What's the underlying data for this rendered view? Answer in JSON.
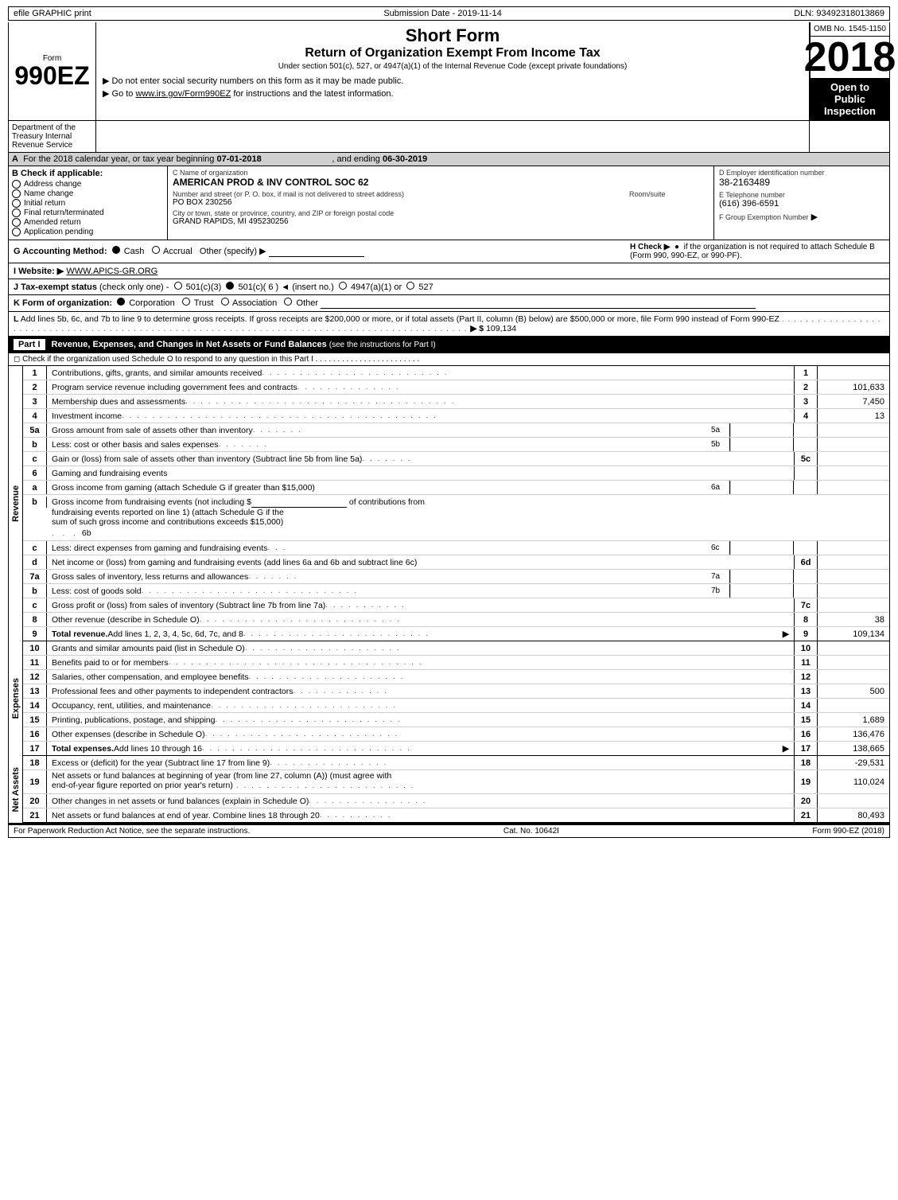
{
  "topbar": {
    "efile": "efile GRAPHIC print",
    "submission": "Submission Date - 2019-11-14",
    "dln": "DLN: 93492318013869"
  },
  "header": {
    "omb": "OMB No. 1545-1150",
    "form_label": "Form",
    "form_number": "990EZ",
    "short_form": "Short Form",
    "return_title": "Return of Organization Exempt From Income Tax",
    "under_title": "Under section 501(c), 527, or 4947(a)(1) of the Internal Revenue Code (except private foundations)",
    "year": "2018",
    "open_label": "Open to",
    "public_label": "Public",
    "inspection_label": "Inspection",
    "notice1": "▶ Do not enter social security numbers on this form as it may be made public.",
    "notice2": "▶ Go to www.irs.gov/Form990EZ for instructions and the latest information."
  },
  "dept": {
    "name": "Department of the Treasury Internal Revenue Service"
  },
  "section_a": {
    "text": "A  For the 2018 calendar year, or tax year beginning 07-01-2018",
    "text2": ", and ending 06-30-2019"
  },
  "checkboxes": {
    "b_label": "B  Check if applicable:",
    "address_change": "Address change",
    "name_change": "Name change",
    "initial_return": "Initial return",
    "final_return": "Final return/terminated",
    "amended_return": "Amended return",
    "application_pending": "Application pending"
  },
  "org": {
    "c_label": "C Name of organization",
    "name": "AMERICAN PROD & INV CONTROL SOC 62",
    "address_label": "Number and street (or P. O. box, if mail is not delivered to street address)",
    "address": "PO BOX 230256",
    "room_label": "Room/suite",
    "room": "",
    "city_label": "City or town, state or province, country, and ZIP or foreign postal code",
    "city": "GRAND RAPIDS, MI  495230256"
  },
  "employer": {
    "d_label": "D Employer identification number",
    "ein": "38-2163489",
    "e_label": "E Telephone number",
    "phone": "(616) 396-6591",
    "f_label": "F Group Exemption Number",
    "f_arrow": "▶"
  },
  "accounting": {
    "g_label": "G Accounting Method:",
    "cash": "Cash",
    "accrual": "Accrual",
    "other": "Other (specify) ▶",
    "other_field": "",
    "h_label": "H  Check ▶",
    "h_circle": "●",
    "h_text": "if the organization is not required to attach Schedule B (Form 990, 990-EZ, or 990-PF)."
  },
  "website": {
    "i_label": "I Website: ▶",
    "url": "WWW.APICS-GR.ORG"
  },
  "tax_status": {
    "j_label": "J Tax-exempt status",
    "j_sub": "(check only one) -",
    "c3": "501(c)(3)",
    "c6": "501(c)( 6 )",
    "insert": "◄ (insert no.)",
    "c4947": "4947(a)(1) or",
    "c527": "527"
  },
  "form_org": {
    "k_label": "K Form of organization:",
    "corporation": "Corporation",
    "trust": "Trust",
    "association": "Association",
    "other": "Other"
  },
  "l_row": {
    "text": "L Add lines 5b, 6c, and 7b to line 9 to determine gross receipts. If gross receipts are $200,000 or more, or if total assets (Part II, column (B) below) are $500,000 or more, file Form 990 instead of Form 990-EZ",
    "dots": ". . . . . . . . . . . . . . . . . . . . . . . . . . . . . . . . . . . . . . . . . .",
    "arrow": "▶ $",
    "value": "109,134"
  },
  "part1": {
    "label": "Part I",
    "title": "Revenue, Expenses, and Changes in Net Assets or Fund Balances",
    "title_sub": "(see the instructions for Part I)",
    "check_row": "Check if the organization used Schedule O to respond to any question in this Part I . . . . . . . . . . . . . . . . . . . . . . . .",
    "check_box": "◻"
  },
  "rows": [
    {
      "num": "1",
      "desc": "Contributions, gifts, grants, and similar amounts received . . . . . . . . . . . . . . . . . . . . . . . . .",
      "line": "1",
      "value": ""
    },
    {
      "num": "2",
      "desc": "Program service revenue including government fees and contracts . . . . . . . . . . . . . .",
      "line": "2",
      "value": "101,633"
    },
    {
      "num": "3",
      "desc": "Membership dues and assessments . . . . . . . . . . . . . . . . . . . . . . . . . . . . . . . . . . .",
      "line": "3",
      "value": "7,450"
    },
    {
      "num": "4",
      "desc": "Investment income . . . . . . . . . . . . . . . . . . . . . . . . . . . . . . . . . . . . . . . . . .",
      "line": "4",
      "value": "13"
    }
  ],
  "row5a": {
    "num": "5a",
    "desc": "Gross amount from sale of assets other than inventory . . . . . . .",
    "sub": "5a",
    "line": "",
    "value": ""
  },
  "row5b": {
    "num": "b",
    "desc": "Less: cost or other basis and sales expenses . . . . . . . .",
    "sub": "5b",
    "line": "",
    "value": ""
  },
  "row5c": {
    "num": "c",
    "desc": "Gain or (loss) from sale of assets other than inventory (Subtract line 5b from line 5a) . . . . . . .",
    "line": "5c",
    "value": ""
  },
  "row6": {
    "num": "6",
    "desc": "Gaming and fundraising events",
    "line": "",
    "value": ""
  },
  "row6a": {
    "num": "a",
    "desc": "Gross income from gaming (attach Schedule G if greater than $15,000)",
    "sub": "6a",
    "line": "",
    "value": ""
  },
  "row6b_text": "Gross income from fundraising events (not including $",
  "row6b_text2": "of contributions from fundraising events reported on line 1) (attach Schedule G if the sum of such gross income and contributions exceeds $15,000)",
  "row6b_sub": "6b",
  "row6c": {
    "num": "c",
    "desc": "Less: direct expenses from gaming and fundraising events",
    "sub": "6c",
    "value": ""
  },
  "row6d": {
    "num": "d",
    "desc": "Net income or (loss) from gaming and fundraising events (add lines 6a and 6b and subtract line 6c)",
    "line": "6d",
    "value": ""
  },
  "row7a": {
    "num": "7a",
    "desc": "Gross sales of inventory, less returns and allowances . . . . . . .",
    "sub": "7a",
    "value": ""
  },
  "row7b": {
    "num": "b",
    "desc": "Less: cost of goods sold . . . . . . . . . . . . . . . . . . . . . . . .",
    "sub": "7b",
    "value": ""
  },
  "row7c": {
    "num": "c",
    "desc": "Gross profit or (loss) from sales of inventory (Subtract line 7b from line 7a) . . . . . . . . . . . .",
    "line": "7c",
    "value": ""
  },
  "row8": {
    "num": "8",
    "desc": "Other revenue (describe in Schedule O) . . . . . . . . . . . . . . . . . . . . . . . . . . . . . .",
    "line": "8",
    "value": "38"
  },
  "row9": {
    "num": "9",
    "desc": "Total revenue. Add lines 1, 2, 3, 4, 5c, 6d, 7c, and 8 . . . . . . . . . . . . . . . . . . . . . . . . . .",
    "line": "9",
    "value": "109,134",
    "arrow": "▶"
  },
  "row10": {
    "num": "10",
    "desc": "Grants and similar amounts paid (list in Schedule O) . . . . . . . . . . . . . . . . . . . . . .",
    "line": "10",
    "value": ""
  },
  "row11": {
    "num": "11",
    "desc": "Benefits paid to or for members . . . . . . . . . . . . . . . . . . . . . . . . . . . . . . . . . .",
    "line": "11",
    "value": ""
  },
  "row12": {
    "num": "12",
    "desc": "Salaries, other compensation, and employee benefits . . . . . . . . . . . . . . . . . . . . .",
    "line": "12",
    "value": ""
  },
  "row13": {
    "num": "13",
    "desc": "Professional fees and other payments to independent contractors . . . . . . . . . . . . . .",
    "line": "13",
    "value": "500"
  },
  "row14": {
    "num": "14",
    "desc": "Occupancy, rent, utilities, and maintenance . . . . . . . . . . . . . . . . . . . . . . . . . . .",
    "line": "14",
    "value": ""
  },
  "row15": {
    "num": "15",
    "desc": "Printing, publications, postage, and shipping . . . . . . . . . . . . . . . . . . . . . . . . . .",
    "line": "15",
    "value": "1,689"
  },
  "row16": {
    "num": "16",
    "desc": "Other expenses (describe in Schedule O) . . . . . . . . . . . . . . . . . . . . . . . . . . . .",
    "line": "16",
    "value": "136,476"
  },
  "row17": {
    "num": "17",
    "desc": "Total expenses. Add lines 10 through 16 . . . . . . . . . . . . . . . . . . . . . . . . . . . . .",
    "line": "17",
    "value": "138,665",
    "arrow": "▶"
  },
  "row18": {
    "num": "18",
    "desc": "Excess or (deficit) for the year (Subtract line 17 from line 9) . . . . . . . . . . . . . . . . .",
    "line": "18",
    "value": "-29,531"
  },
  "row19_text": "Net assets or fund balances at beginning of year (from line 27, column (A)) (must agree with end-of-year figure reported on prior year's return)",
  "row19": {
    "num": "19",
    "line": "19",
    "value": "110,024"
  },
  "row20": {
    "num": "20",
    "desc": "Other changes in net assets or fund balances (explain in Schedule O) . . . . . . . . . . . . . . . .",
    "line": "20",
    "value": ""
  },
  "row21": {
    "num": "21",
    "desc": "Net assets or fund balances at end of year. Combine lines 18 through 20 . . . . . . . . . . .",
    "line": "21",
    "value": "80,493"
  },
  "footer": {
    "left": "For Paperwork Reduction Act Notice, see the separate instructions.",
    "center": "Cat. No. 10642I",
    "right": "Form 990-EZ (2018)"
  }
}
